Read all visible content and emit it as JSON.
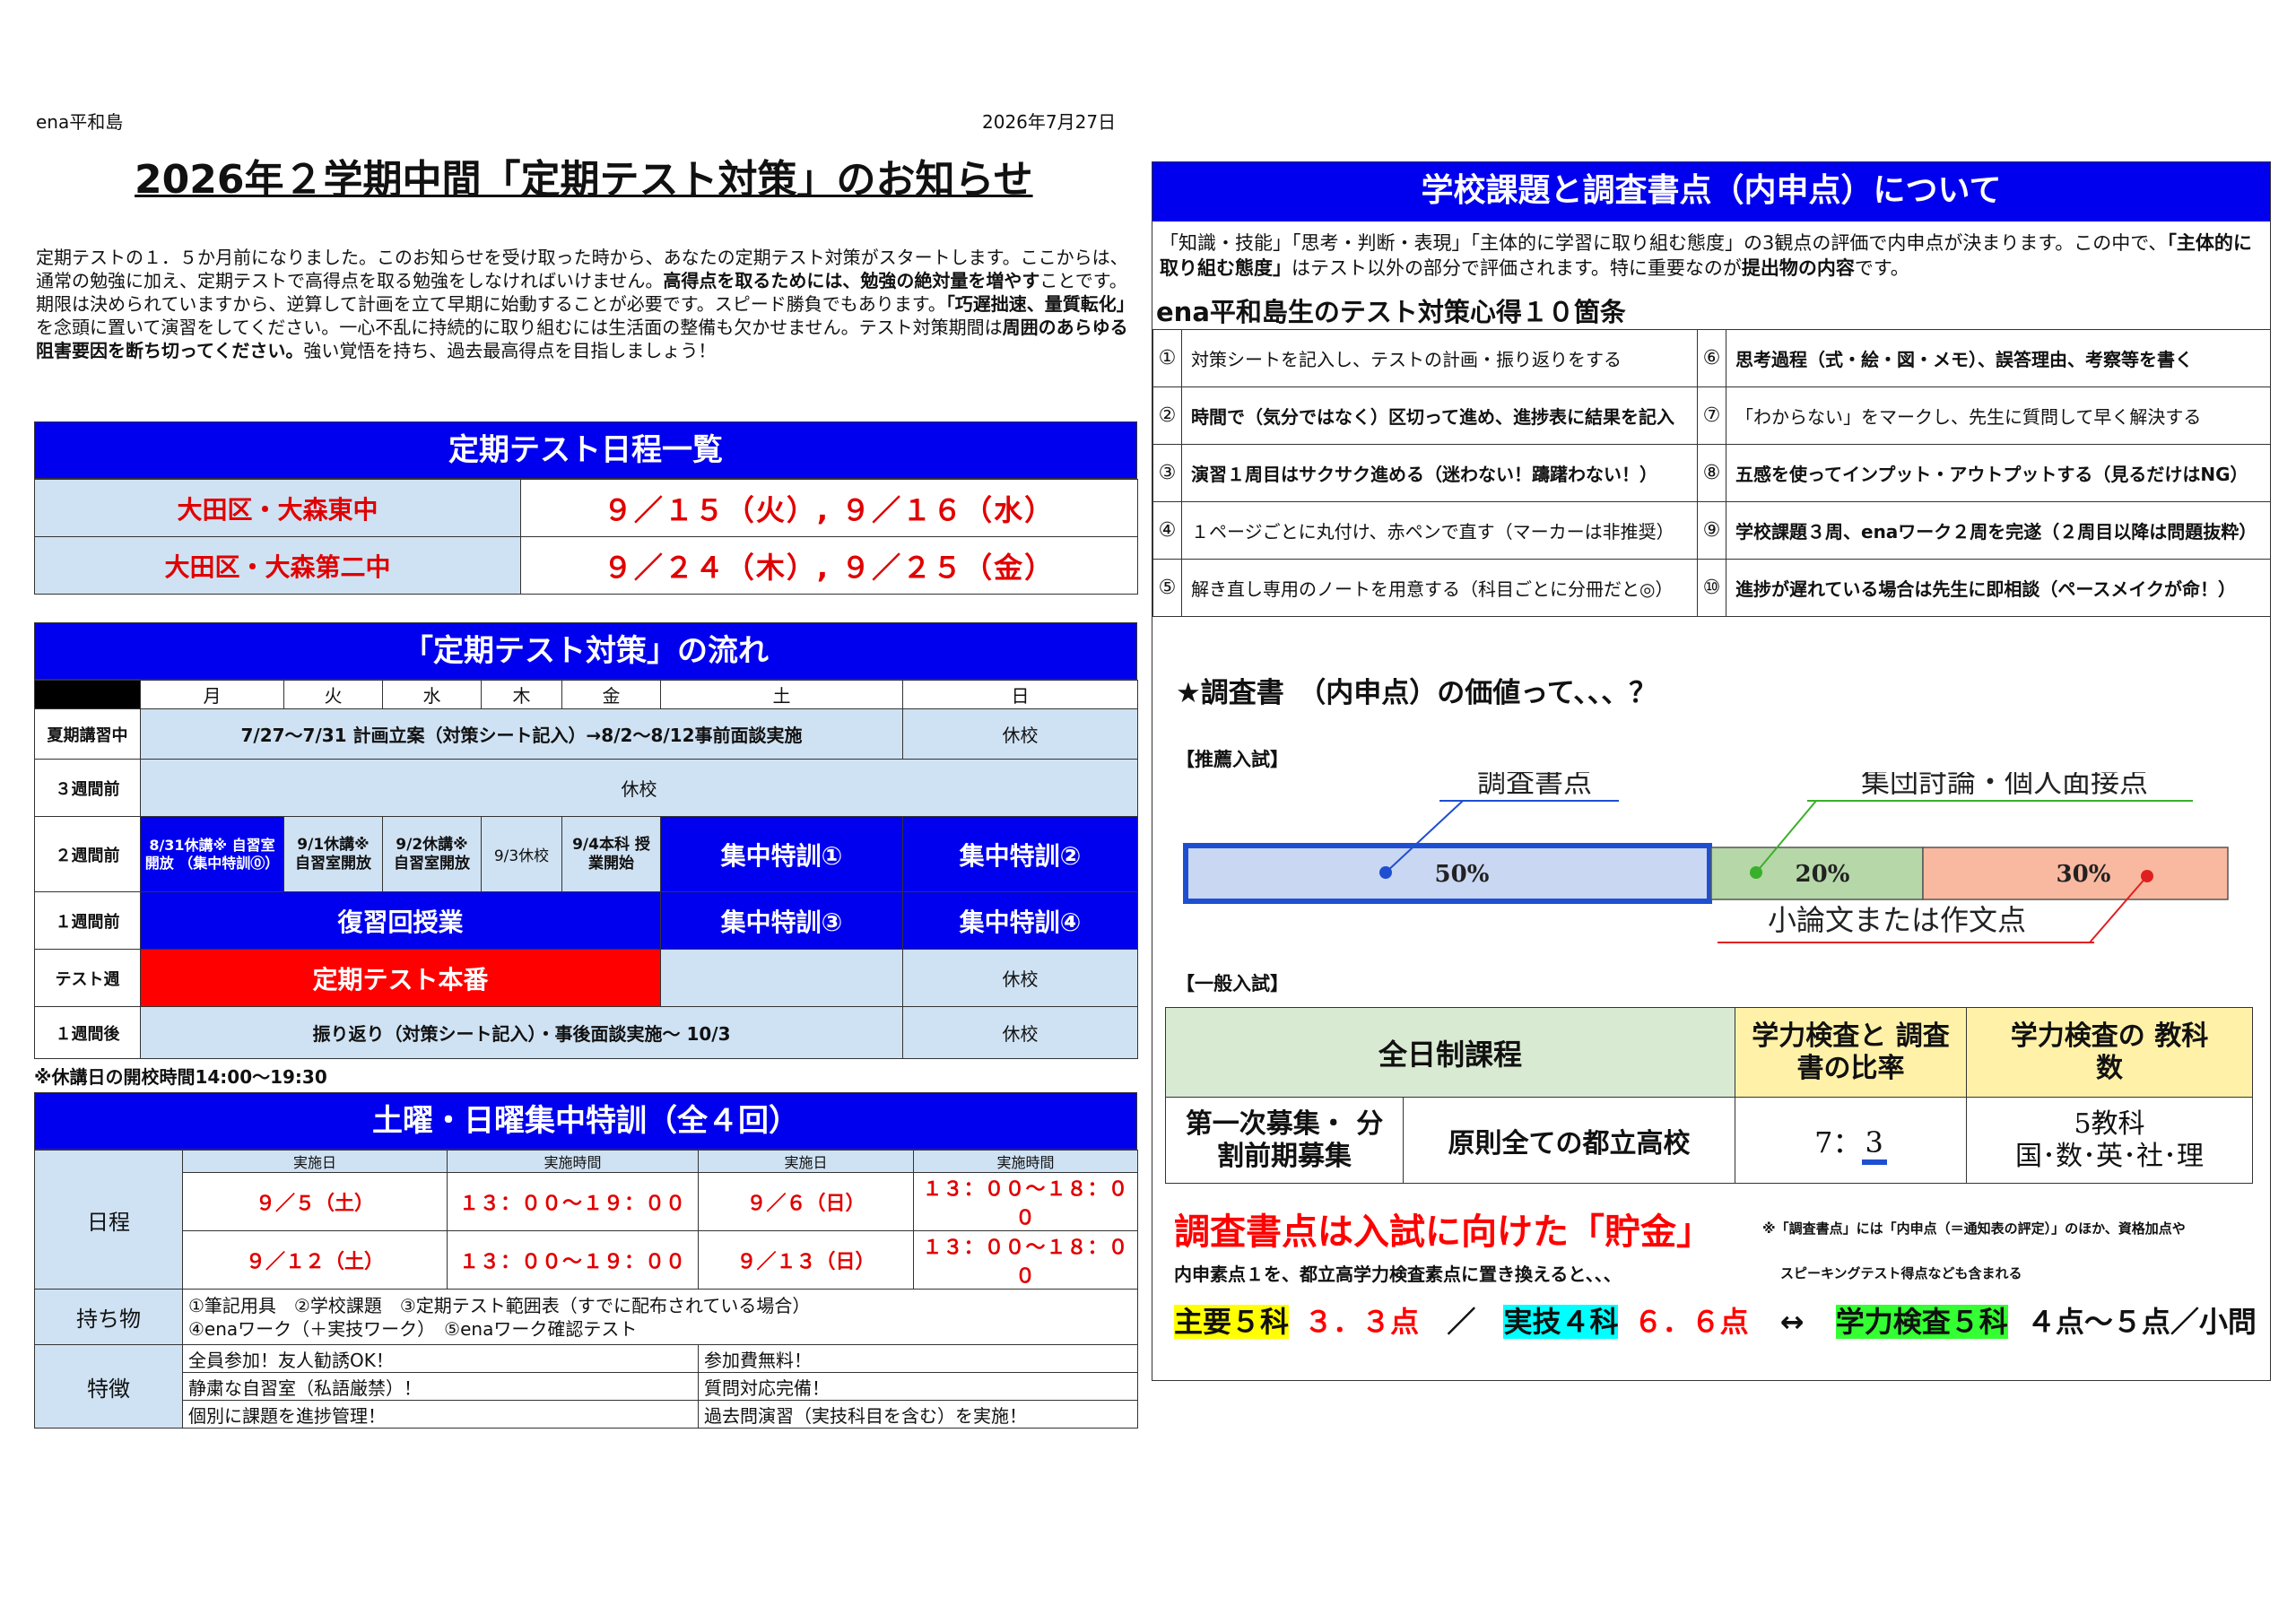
{
  "header": {
    "school": "ena平和島",
    "date": "2026年7月27日"
  },
  "title": "2026年２学期中間「定期テスト対策」のお知らせ",
  "intro": {
    "p1": "定期テストの１．５か月前になりました。このお知らせを受け取った時から、あなたの定期テスト対策がスタートします。ここからは、通常の勉強に加え、定期テストで高得点を取る勉強をしなければいけません。",
    "b1": "高得点を取るためには、勉強の絶対量を増やす",
    "p2": "ことです。期限は決められていますから、逆算して計画を立て早期に始動することが必要です。スピード勝負でもあります。",
    "b2": "「巧遅拙速、量質転化」",
    "p3": "を念頭に置いて演習をしてください。一心不乱に持続的に取り組むには生活面の整備も欠かせません。テスト対策期間は",
    "b3": "周囲のあらゆる阻害要因を断ち切ってください。",
    "p4": "強い覚悟を持ち、過去最高得点を目指しましょう！"
  },
  "schedule": {
    "title": "定期テスト日程一覧",
    "rows": [
      {
        "school": "大田区・大森東中",
        "dates": "９／１５（火）, ９／１６（水）"
      },
      {
        "school": "大田区・大森第二中",
        "dates": "９／２４（木）, ９／２５（金）"
      }
    ]
  },
  "flow": {
    "title": "「定期テスト対策」の流れ",
    "days": [
      "月",
      "火",
      "水",
      "木",
      "金",
      "土",
      "日"
    ],
    "row1": {
      "label": "夏期講習中",
      "main": "7/27〜7/31 計画立案（対策シート記入）→8/2〜8/12事前面談実施",
      "sun": "休校"
    },
    "row2": {
      "label": "３週間前",
      "main": "休校"
    },
    "row3": {
      "label": "２週間前",
      "mon": "8/31休講※ 自習室開放 （集中特訓⓪）",
      "tue": "9/1休講※ 自習室開放",
      "wed": "9/2休講※ 自習室開放",
      "thu": "9/3休校",
      "fri": "9/4本科 授業開始",
      "sat": "集中特訓①",
      "sun": "集中特訓②"
    },
    "row4": {
      "label": "１週間前",
      "main": "復習回授業",
      "sat": "集中特訓③",
      "sun": "集中特訓④"
    },
    "row5": {
      "label": "テスト週",
      "main": "定期テスト本番",
      "sun": "休校"
    },
    "row6": {
      "label": "１週間後",
      "main": "振り返り（対策シート記入）・事後面談実施〜 10/3",
      "sun": "休校"
    },
    "note": "※休講日の開校時間14:00〜19:30"
  },
  "intensive": {
    "title": "土曜・日曜集中特訓（全４回）",
    "head": [
      "実施日",
      "実施時間",
      "実施日",
      "実施時間"
    ],
    "schedule_label": "日程",
    "rows": [
      [
        "９／５（土）",
        "１３：００〜１９：００",
        "９／６（日）",
        "１３：００〜１８：００"
      ],
      [
        "９／１２（土）",
        "１３：００〜１９：００",
        "９／１３（日）",
        "１３：００〜１８：００"
      ]
    ],
    "items_label": "持ち物",
    "items1": "①筆記用具　②学校課題　③定期テスト範囲表（すでに配布されている場合）",
    "items2": "④enaワーク（＋実技ワーク）　⑤enaワーク確認テスト",
    "features_label": "特徴",
    "features": [
      [
        "全員参加！友人勧誘OK！",
        "参加費無料！"
      ],
      [
        "静粛な自習室（私語厳禁）！",
        "質問対応完備！"
      ],
      [
        "個別に課題を進捗管理！",
        "過去問演習（実技科目を含む）を実施！"
      ]
    ]
  },
  "right": {
    "title": "学校課題と調査書点（内申点）について",
    "p1": "「知識・技能」「思考・判断・表現」「主体的に学習に取り組む態度」の3観点の評価で内申点が決まります。この中で、",
    "b1": "「主体的に取り組む態度」",
    "p2": "はテスト以外の部分で評価されます。特に重要なのが",
    "b2": "提出物の内容",
    "p3": "です。",
    "tips_title": "ena平和島生のテスト対策心得１０箇条",
    "tips": [
      {
        "n": "①",
        "t": "対策シートを記入し、テストの計画・振り返りをする",
        "bold": false
      },
      {
        "n": "⑥",
        "t": "思考過程（式・絵・図・メモ）、誤答理由、考察等を書く",
        "bold": true
      },
      {
        "n": "②",
        "t": "時間で（気分ではなく）区切って進め、進捗表に結果を記入",
        "bold": true
      },
      {
        "n": "⑦",
        "t": "「わからない」をマークし、先生に質問して早く解決する",
        "bold": false
      },
      {
        "n": "③",
        "t": "演習１周目はサクサク進める（迷わない！躊躇わない！）",
        "bold": true
      },
      {
        "n": "⑧",
        "t": "五感を使ってインプット・アウトプットする（見るだけはNG）",
        "bold": true
      },
      {
        "n": "④",
        "t": "１ページごとに丸付け、赤ペンで直す（マーカーは非推奨）",
        "bold": false
      },
      {
        "n": "⑨",
        "t": "学校課題３周、enaワーク２周を完遂（２周目以降は問題抜粋）",
        "bold": true
      },
      {
        "n": "⑤",
        "t": "解き直し専用のノートを用意する（科目ごとに分冊だと◎）",
        "bold": false
      },
      {
        "n": "⑩",
        "t": "進捗が遅れている場合は先生に即相談（ペースメイクが命！）",
        "bold": true
      }
    ],
    "value_title": "★調査書　（内申点）の価値って、、、？",
    "recommend_label": "【推薦入試】",
    "bar_labels": {
      "report": "調査書点",
      "group": "集団討論・個人面接点",
      "essay": "小論文または作文点"
    },
    "bar_values": [
      "50%",
      "20%",
      "30%"
    ],
    "general_label": "【一般入試】",
    "exam_table": {
      "h1": "全日制課程",
      "h2": "学力検査と 調査書の比率",
      "h3": "学力検査の 教科数",
      "c1": "第一次募集・ 分割前期募集",
      "c2": "原則全ての都立高校",
      "ratio_a": "7：",
      "ratio_b": "3",
      "c4a": "5教科",
      "c4b": "国･数･英･社･理"
    },
    "savings_title": "調査書点は入試に向けた「貯金」",
    "note1": "※「調査書点」には「内申点（＝通知表の評定）」のほか、資格加点や",
    "note2": "スピーキングテスト得点なども含まれる",
    "convert_text": "内申素点１を、都立高学力検査素点に置き換えると､､､",
    "main5_label": "主要５科",
    "main5_value": "３．３点",
    "slash": "／",
    "jitsugi_label": "実技４科",
    "jitsugi_value": "６．６点",
    "arrow": "↔",
    "gakuryoku_label": "学力検査５科",
    "gakuryoku_value": "４点〜５点／小問"
  },
  "colors": {
    "blue": "#0000ee",
    "light_blue": "#cfe2f3",
    "red": "#ff0000",
    "green_bar": "#b6d7a8",
    "salmon": "#f9b9a0"
  }
}
